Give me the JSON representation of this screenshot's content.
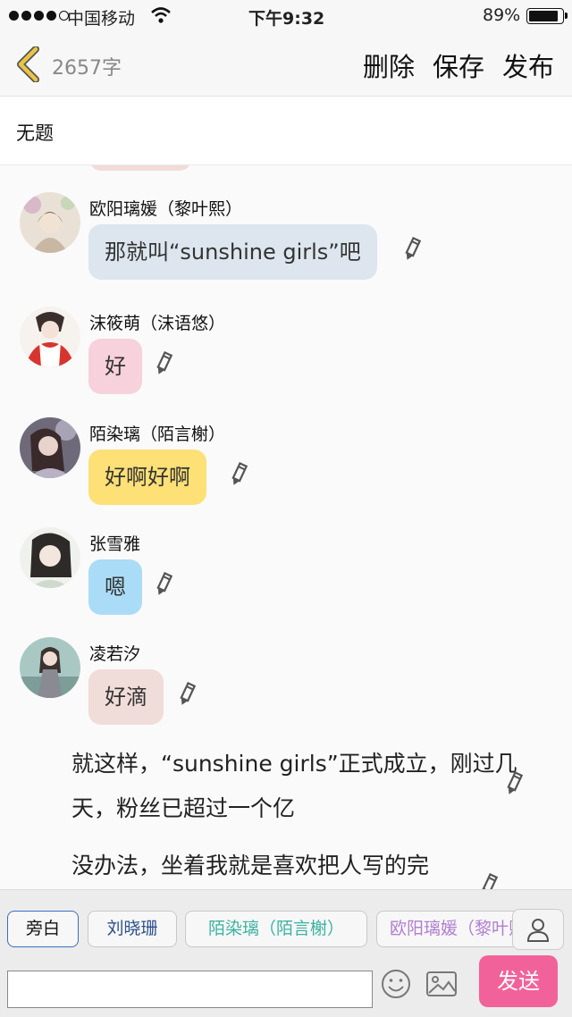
{
  "status_bar": {
    "carrier": "中国移动",
    "time": "下午9:32",
    "battery": "89%",
    "battery_level": 0.89
  },
  "nav": {
    "word_count": "2657字",
    "delete_label": "删除",
    "save_label": "保存",
    "publish_label": "发布"
  },
  "title": "无题",
  "messages": [
    {
      "name": "欧阳璃媛（黎叶熙）",
      "text": "那就叫“sunshine girls”吧",
      "bubble_color": "#dde6ee"
    },
    {
      "name": "沫筱萌（沫语悠）",
      "text": "好",
      "bubble_color": "#f7d1db"
    },
    {
      "name": "陌染璃（陌言榭）",
      "text": "好啊好啊",
      "bubble_color": "#fde076"
    },
    {
      "name": "张雪雅",
      "text": "嗯",
      "bubble_color": "#abdcf7"
    },
    {
      "name": "凌若汐",
      "text": "好滴",
      "bubble_color": "#f0dcd9"
    }
  ],
  "narration": [
    {
      "text": "就这样，“sunshine girls”正式成立，刚过几天，粉丝已超过一个亿"
    },
    {
      "text": "没办法，坐着我就是喜欢把人写的完"
    }
  ],
  "roles": [
    {
      "label": "旁白",
      "color": "#111111",
      "active": true
    },
    {
      "label": "刘晓珊",
      "color": "#2d4f8c",
      "active": false
    },
    {
      "label": "陌染璃（陌言榭）",
      "color": "#3bb3a2",
      "active": false
    },
    {
      "label": "欧阳璃媛（黎叶熙）",
      "color": "#b07fd0",
      "active": false
    }
  ],
  "input": {
    "value": "",
    "placeholder": ""
  },
  "send_label": "发送",
  "colors": {
    "accent_send": "#f2629a",
    "back_chevron": "#e8c545"
  },
  "icons": [
    "back-chevron-icon",
    "wifi-icon",
    "battery-icon",
    "pencil-icon",
    "person-icon",
    "emoji-icon",
    "image-icon"
  ]
}
